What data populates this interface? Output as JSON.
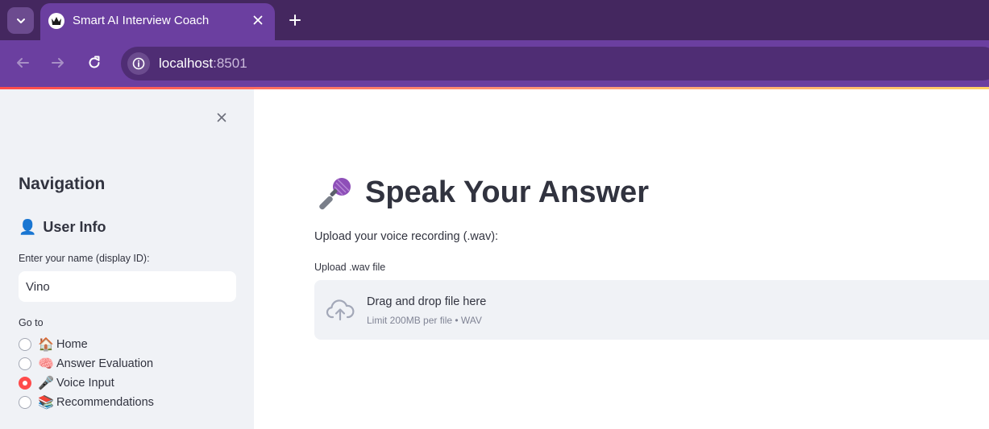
{
  "browser": {
    "tab_title": "Smart AI Interview Coach",
    "url_host": "localhost",
    "url_port": ":8501"
  },
  "sidebar": {
    "heading": "Navigation",
    "user_info_heading": "User Info",
    "user_info_emoji": "👤",
    "name_label": "Enter your name (display ID):",
    "name_value": "Vino",
    "goto_label": "Go to",
    "options": [
      {
        "emoji": "🏠",
        "label": "Home",
        "selected": false
      },
      {
        "emoji": "🧠",
        "label": "Answer Evaluation",
        "selected": false
      },
      {
        "emoji": "🎤",
        "label": "Voice Input",
        "selected": true
      },
      {
        "emoji": "📚",
        "label": "Recommendations",
        "selected": false
      }
    ]
  },
  "main": {
    "title_emoji": "🎤",
    "title": "Speak Your Answer",
    "upload_caption": "Upload your voice recording (.wav):",
    "uploader_label": "Upload .wav file",
    "drop_main": "Drag and drop file here",
    "drop_sub": "Limit 200MB per file • WAV"
  },
  "colors": {
    "chrome_dark": "#44275f",
    "chrome_purple": "#6b3fa0",
    "accent_red": "#ff4b4b",
    "sidebar_bg": "#f0f2f6",
    "text": "#31333f"
  }
}
